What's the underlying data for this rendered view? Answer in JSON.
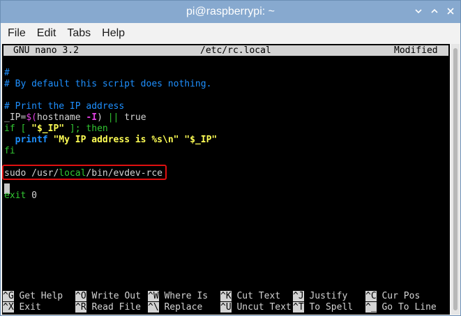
{
  "window": {
    "title": "pi@raspberrypi: ~"
  },
  "menu": [
    "File",
    "Edit",
    "Tabs",
    "Help"
  ],
  "nano": {
    "version": "GNU nano 3.2",
    "filename": "/etc/rc.local",
    "state": "Modified"
  },
  "editor": {
    "lines": [
      "#",
      "# By default this script does nothing.",
      "",
      "# Print the IP address",
      "_IP=$(hostname -I) || true",
      "if [ \"$_IP\" ]; then",
      "  printf \"My IP address is %s\\n\" \"$_IP\"",
      "fi",
      "",
      "sudo /usr/local/bin/evdev-rce",
      "",
      "exit 0"
    ],
    "tokens": {
      "ip_assign_a": "_IP=",
      "ip_assign_b": "$(",
      "ip_assign_c": "hostname ",
      "ip_assign_d": "-I",
      "ip_assign_e": ") ",
      "ip_assign_f": "|| ",
      "ip_assign_g": "true",
      "if_a": "if [ ",
      "if_b": "\"$_IP\"",
      "if_c": " ]; then",
      "printf_a": "  printf ",
      "printf_b": "\"My IP address is %s\\n\"",
      "printf_c": " ",
      "printf_d": "\"$_IP\"",
      "sudo_a": "sudo /usr/",
      "sudo_b": "local",
      "sudo_c": "/bin/evdev-rce",
      "exit_a": "exit ",
      "exit_b": "0"
    }
  },
  "shortcuts": [
    {
      "key": "^G",
      "label": "Get Help"
    },
    {
      "key": "^O",
      "label": "Write Out"
    },
    {
      "key": "^W",
      "label": "Where Is"
    },
    {
      "key": "^K",
      "label": "Cut Text"
    },
    {
      "key": "^J",
      "label": "Justify"
    },
    {
      "key": "^C",
      "label": "Cur Pos"
    },
    {
      "key": "^X",
      "label": "Exit"
    },
    {
      "key": "^R",
      "label": "Read File"
    },
    {
      "key": "^\\",
      "label": "Replace"
    },
    {
      "key": "^U",
      "label": "Uncut Text"
    },
    {
      "key": "^T",
      "label": "To Spell"
    },
    {
      "key": "^_",
      "label": "Go To Line"
    }
  ],
  "icons": {
    "minimize": "minimize-icon",
    "maximize": "maximize-icon",
    "close": "close-icon"
  },
  "colors": {
    "titlebar": "#87a9cf",
    "terminal_bg": "#000000",
    "comment": "#1e90ff",
    "keyword": "#32c832",
    "string": "#ffff55",
    "highlight_box": "#e01010"
  }
}
